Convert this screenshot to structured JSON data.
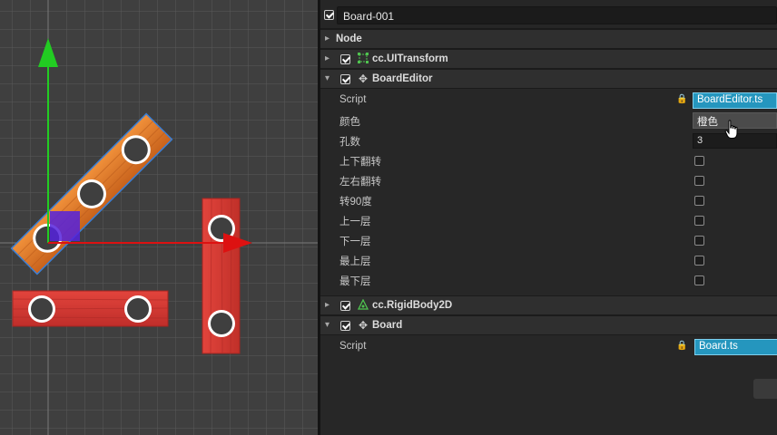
{
  "node": {
    "name": "Board-001",
    "active": true
  },
  "components": {
    "node": {
      "title": "Node",
      "expanded": false
    },
    "uitransform": {
      "title": "cc.UITransform",
      "icon": "transform-icon",
      "expanded": false,
      "enabled": true
    },
    "boardeditor": {
      "title": "BoardEditor",
      "icon": "puzzle-icon",
      "expanded": true,
      "enabled": true,
      "props": {
        "script_label": "Script",
        "script_value": "BoardEditor.ts",
        "color_label": "颜色",
        "color_value": "橙色",
        "holes_label": "孔数",
        "holes_value": "3",
        "flip_v_label": "上下翻转",
        "flip_h_label": "左右翻转",
        "rotate_label": "转90度",
        "layer_up_label": "上一层",
        "layer_down_label": "下一层",
        "layer_top_label": "最上层",
        "layer_bottom_label": "最下层"
      }
    },
    "rigidbody": {
      "title": "cc.RigidBody2D",
      "icon": "rigidbody-icon",
      "expanded": false,
      "enabled": true
    },
    "board": {
      "title": "Board",
      "icon": "puzzle-icon",
      "expanded": true,
      "enabled": true,
      "props": {
        "script_label": "Script",
        "script_value": "Board.ts"
      }
    }
  },
  "colors": {
    "scene_bg": "#3f3f3f",
    "grid": "#6a6a6a",
    "orange_board": "#e07a2c",
    "red_board": "#d83b36",
    "gizmo_y": "#22cc22",
    "gizmo_x": "#dd1111",
    "gizmo_center": "#5522dd",
    "asset_field": "#2596be"
  }
}
